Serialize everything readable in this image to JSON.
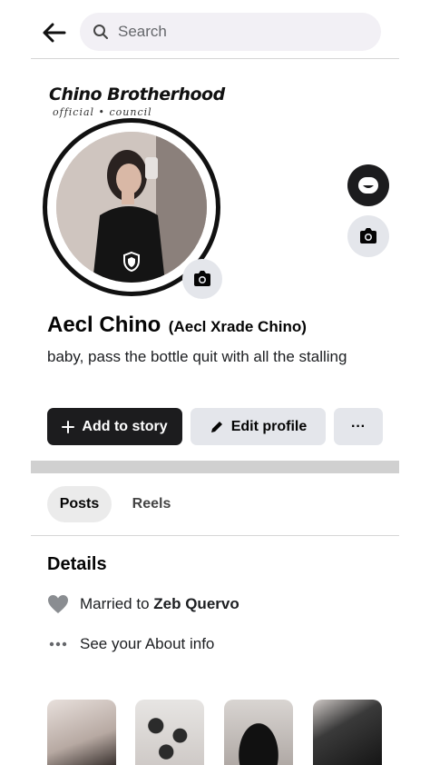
{
  "search": {
    "placeholder": "Search"
  },
  "cover": {
    "title": "Chino Brotherhood",
    "subtitle": "official • council"
  },
  "profile": {
    "name": "Aecl Chino",
    "alt_name": "(Aecl Xrade Chino)",
    "bio": "baby, pass the bottle quit with all the stalling"
  },
  "actions": {
    "add_story": "Add to story",
    "edit_profile": "Edit profile",
    "more": "···"
  },
  "tabs": [
    {
      "label": "Posts",
      "active": true
    },
    {
      "label": "Reels",
      "active": false
    }
  ],
  "details": {
    "title": "Details",
    "married_prefix": "Married to",
    "married_name": "Zeb Quervo",
    "about": "See your About info"
  },
  "icons": {
    "back": "arrow-left-icon",
    "search": "search-icon",
    "avatar_camera": "camera-icon",
    "side_top": "avatar-icon",
    "side_camera": "camera-icon",
    "shield": "shield-icon",
    "plus": "plus-icon",
    "pencil": "pencil-icon",
    "heart": "heart-icon",
    "dots": "more-dots-icon"
  },
  "colors": {
    "dark_button": "#1c1c1e",
    "light_button": "#e4e6eb",
    "search_bg": "#f2f0f5",
    "divider": "#d6d6d6"
  }
}
